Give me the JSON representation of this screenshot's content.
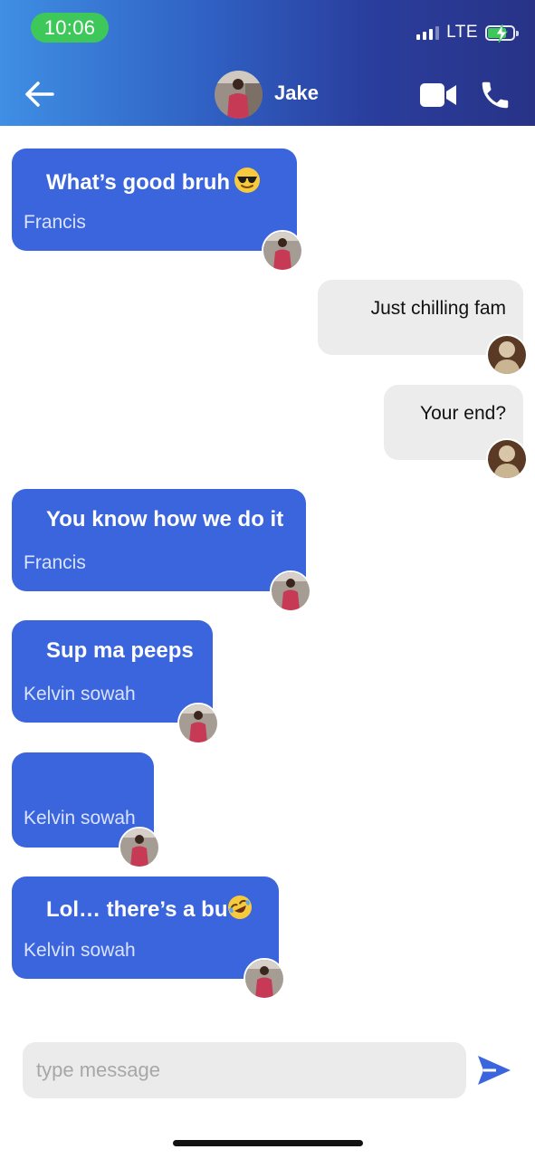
{
  "status_bar": {
    "time": "10:06",
    "network": "LTE"
  },
  "header": {
    "contact_name": "Jake",
    "back_icon": "arrow-left-icon",
    "video_icon": "video-camera-icon",
    "call_icon": "phone-icon",
    "gradient": [
      "#3f8fe4",
      "#283387"
    ]
  },
  "colors": {
    "incoming_bubble": "#3b65dc",
    "outgoing_bubble": "#ececec",
    "send_accent": "#3b65dc"
  },
  "messages": [
    {
      "direction": "in",
      "text": "What’s good bruh",
      "emoji": "sunglasses",
      "sender": "Francis"
    },
    {
      "direction": "out",
      "text": "Just chilling fam"
    },
    {
      "direction": "out",
      "text": "Your end?"
    },
    {
      "direction": "in",
      "text": "You know how we do it",
      "sender": "Francis"
    },
    {
      "direction": "in",
      "text": "Sup ma peeps",
      "sender": "Kelvin sowah"
    },
    {
      "direction": "in",
      "text": "",
      "sender": "Kelvin sowah"
    },
    {
      "direction": "in",
      "text": "Lol… there’s a bu",
      "emoji": "rofl",
      "sender": "Kelvin sowah"
    }
  ],
  "composer": {
    "placeholder": "type message",
    "send_icon": "send-icon"
  }
}
